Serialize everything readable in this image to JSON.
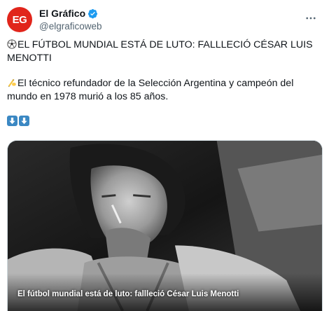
{
  "account": {
    "avatar_text": "EG",
    "display_name": "El Gráfico",
    "handle": "@elgraficoweb",
    "verified": true
  },
  "tweet": {
    "headline": "EL FÚTBOL MUNDIAL ESTÁ DE LUTO: FALLLECIÓ CÉSAR LUIS MENOTTI",
    "body": "El técnico refundador de la Selección Argentina y campeón del mundo en 1978 murió a los 85 años."
  },
  "media": {
    "caption": "El fútbol mundial está de luto: fallleció César Luis Menotti"
  },
  "colors": {
    "brand": "#e1251b",
    "verified": "#1d9bf0",
    "text_secondary": "#536471",
    "arrow_emoji": "#3b88c3"
  },
  "icons": [
    "verified-icon",
    "more-icon",
    "soccer-ball-icon",
    "writing-hand-icon",
    "arrow-down-icon"
  ]
}
